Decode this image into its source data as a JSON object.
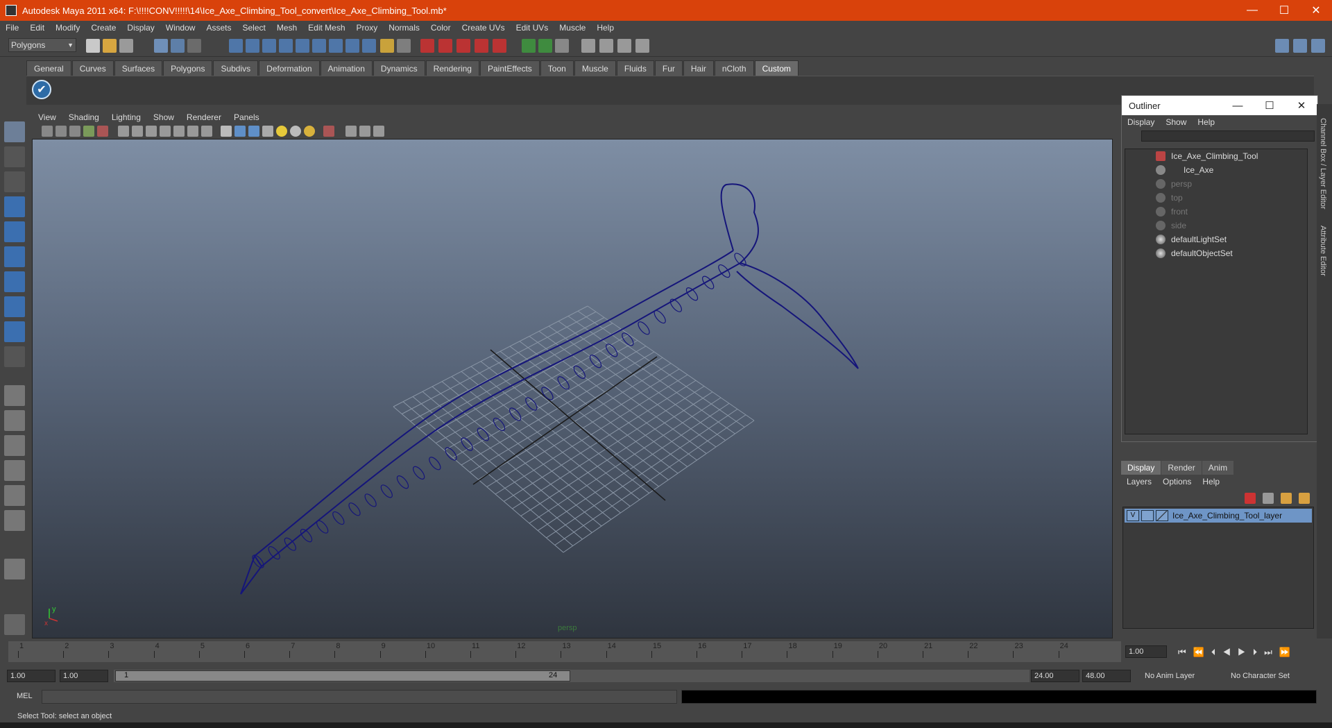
{
  "window": {
    "title": "Autodesk Maya 2011 x64: F:\\!!!!CONV!!!!!\\14\\Ice_Axe_Climbing_Tool_convert\\Ice_Axe_Climbing_Tool.mb*",
    "minimize": "—",
    "maximize": "☐",
    "close": "✕"
  },
  "menubar": [
    "File",
    "Edit",
    "Modify",
    "Create",
    "Display",
    "Window",
    "Assets",
    "Select",
    "Mesh",
    "Edit Mesh",
    "Proxy",
    "Normals",
    "Color",
    "Create UVs",
    "Edit UVs",
    "Muscle",
    "Help"
  ],
  "statusline": {
    "mode": "Polygons"
  },
  "shelf": {
    "tabs": [
      "General",
      "Curves",
      "Surfaces",
      "Polygons",
      "Subdivs",
      "Deformation",
      "Animation",
      "Dynamics",
      "Rendering",
      "PaintEffects",
      "Toon",
      "Muscle",
      "Fluids",
      "Fur",
      "Hair",
      "nCloth",
      "Custom"
    ],
    "active_tab": "Custom",
    "icon_glyph": "✔"
  },
  "panel": {
    "menus": [
      "View",
      "Shading",
      "Lighting",
      "Show",
      "Renderer",
      "Panels"
    ],
    "camera": "persp",
    "axis_y": "y",
    "axis_x": "x"
  },
  "outliner": {
    "title": "Outliner",
    "menus": [
      "Display",
      "Show",
      "Help"
    ],
    "items": [
      {
        "label": "Ice_Axe_Climbing_Tool",
        "dim": false
      },
      {
        "label": "Ice_Axe",
        "dim": false
      },
      {
        "label": "persp",
        "dim": true
      },
      {
        "label": "top",
        "dim": true
      },
      {
        "label": "front",
        "dim": true
      },
      {
        "label": "side",
        "dim": true
      },
      {
        "label": "defaultLightSet",
        "dim": false
      },
      {
        "label": "defaultObjectSet",
        "dim": false
      }
    ]
  },
  "sidestrip": {
    "channel_box": "Channel Box / Layer Editor",
    "attribute_editor": "Attribute Editor"
  },
  "layers": {
    "tabs": [
      "Display",
      "Render",
      "Anim"
    ],
    "active_tab": "Display",
    "menus": [
      "Layers",
      "Options",
      "Help"
    ],
    "layer_name": "Ice_Axe_Climbing_Tool_layer",
    "visible_flag": "V"
  },
  "timeslider": {
    "ticks": [
      "1",
      "2",
      "3",
      "4",
      "5",
      "6",
      "7",
      "8",
      "9",
      "10",
      "11",
      "12",
      "13",
      "14",
      "15",
      "16",
      "17",
      "18",
      "19",
      "20",
      "21",
      "22",
      "23",
      "24"
    ],
    "current_frame": "1",
    "current_time": "1.00"
  },
  "range": {
    "start": "1.00",
    "anim_start": "1.00",
    "range_start": "1",
    "range_end": "24",
    "end": "24.00",
    "anim_end": "48.00",
    "anim_layer": "No Anim Layer",
    "character_set": "No Character Set"
  },
  "cmd": {
    "label": "MEL"
  },
  "helpline": "Select Tool: select an object",
  "colors": {
    "title_bar": "#d9420b",
    "wire": "#15157a",
    "layer_highlight": "#6e95c6"
  }
}
